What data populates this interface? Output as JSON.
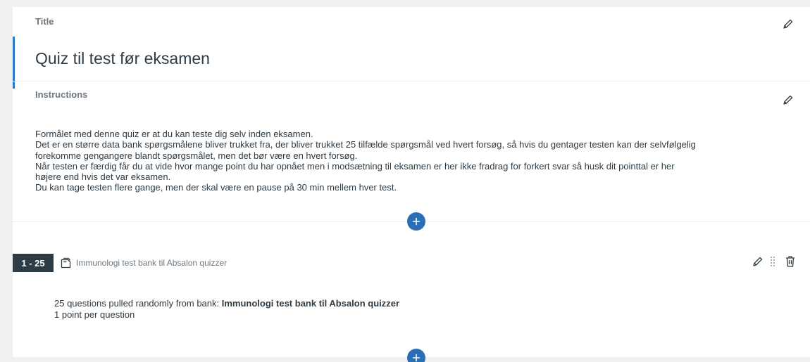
{
  "colors": {
    "accent": "#2d7ac4",
    "brand": "#2a6fb5",
    "text": "#2d3b45",
    "muted": "#6b7780"
  },
  "title_section": {
    "label": "Title",
    "value": "Quiz til test før eksamen",
    "edit_icon": "pencil-icon"
  },
  "instructions_section": {
    "label": "Instructions",
    "edit_icon": "pencil-icon",
    "lines": [
      "Formålet med denne quiz er at du kan teste dig selv inden eksamen.",
      "Det er en større data bank spørgsmålene bliver trukket fra, der bliver trukket 25 tilfælde spørgsmål ved hvert forsøg, så hvis du gentager testen kan der selvfølgelig",
      "forekomme gengangere blandt spørgsmålet, men det bør være en hvert forsøg.",
      "Når testen er færdig får du at vide hvor mange point du har opnået men i modsætning til eksamen er her ikke fradrag for forkert svar så husk dit pointtal er her",
      "højere end hvis det var eksamen.",
      "Du kan tage testen flere gange, men der skal være en pause på 30 min mellem hver test."
    ]
  },
  "add_buttons": {
    "icon": "plus-icon"
  },
  "question_group": {
    "range": "1 - 25",
    "bank_icon": "question-bank-icon",
    "bank_name": "Immunologi test bank til Absalon quizzer",
    "tools": {
      "edit": "pencil-icon",
      "drag": "drag-handle-icon",
      "delete": "trash-icon"
    },
    "pulled_prefix": "25 questions pulled randomly from bank: ",
    "pulled_bank": "Immunologi test bank til Absalon quizzer",
    "points": "1 point per question"
  }
}
